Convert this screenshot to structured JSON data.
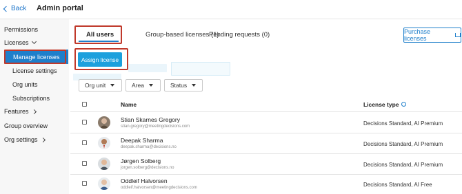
{
  "header": {
    "back_label": "Back",
    "title": "Admin portal"
  },
  "sidebar": {
    "items": [
      {
        "label": "Permissions"
      },
      {
        "label": "Licenses"
      },
      {
        "label": "Manage licenses"
      },
      {
        "label": "License settings"
      },
      {
        "label": "Org units"
      },
      {
        "label": "Subscriptions"
      },
      {
        "label": "Features"
      },
      {
        "label": "Group overview"
      },
      {
        "label": "Org settings"
      }
    ]
  },
  "tabs": [
    {
      "label": "All users"
    },
    {
      "label": "Group-based licenses (1)"
    },
    {
      "label": "Pending requests (0)"
    }
  ],
  "purchase_label": "Purchase licenses",
  "assign_label": "Assign license",
  "filters": [
    {
      "label": "Org unit"
    },
    {
      "label": "Area"
    },
    {
      "label": "Status"
    }
  ],
  "table": {
    "headers": {
      "name": "Name",
      "license_type": "License type"
    },
    "rows": [
      {
        "name": "Stian Skarnes Gregory",
        "email": "stian.gregory@meetingdecisions.com",
        "license": "Decisions Standard, AI Premium"
      },
      {
        "name": "Deepak Sharma",
        "email": "deepak.sharma@decisions.no",
        "license": "Decisions Standard, AI Premium"
      },
      {
        "name": "Jørgen Solberg",
        "email": "jorgen.solberg@decisions.no",
        "license": "Decisions Standard, AI Premium"
      },
      {
        "name": "Oddleif Halvorsen",
        "email": "oddleif.halvorsen@meetingdecisions.com",
        "license": "Decisions Standard, AI Free"
      }
    ]
  },
  "colors": {
    "accent": "#1e7fcb",
    "assign_button": "#1ca0dd",
    "highlight_border": "#c0392b"
  }
}
